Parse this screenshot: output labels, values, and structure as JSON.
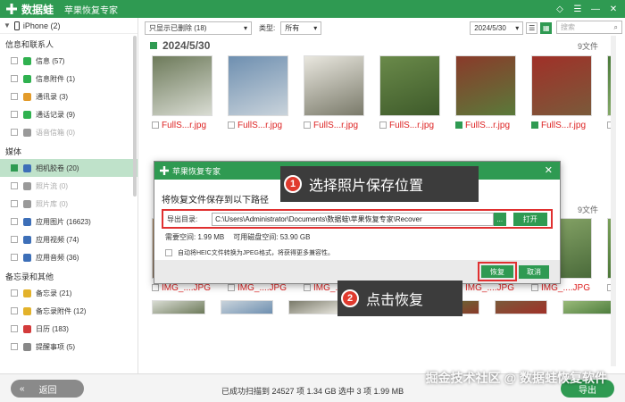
{
  "app": {
    "brand": "数据蛙",
    "title": "苹果恢复专家"
  },
  "device": {
    "label": "iPhone (2)"
  },
  "sidebar": {
    "groups": [
      {
        "title": "信息和联系人",
        "items": [
          {
            "label": "信息 (57)",
            "color": "#2fb14f",
            "disabled": false
          },
          {
            "label": "信息附件 (1)",
            "color": "#2fb14f",
            "disabled": false
          },
          {
            "label": "通讯录 (3)",
            "color": "#e39b2a",
            "disabled": false
          },
          {
            "label": "通话记录 (9)",
            "color": "#2fb14f",
            "disabled": false
          },
          {
            "label": "语音信箱 (0)",
            "color": "#999999",
            "disabled": true
          }
        ]
      },
      {
        "title": "媒体",
        "items": [
          {
            "label": "相机胶卷 (20)",
            "color": "#3d6fb8",
            "disabled": false,
            "active": true,
            "checked": true
          },
          {
            "label": "照片流 (0)",
            "color": "#999999",
            "disabled": true
          },
          {
            "label": "照片库 (0)",
            "color": "#999999",
            "disabled": true
          },
          {
            "label": "应用图片 (16623)",
            "color": "#3d6fb8",
            "disabled": false
          },
          {
            "label": "应用视频 (74)",
            "color": "#3d6fb8",
            "disabled": false
          },
          {
            "label": "应用音频 (36)",
            "color": "#3d6fb8",
            "disabled": false
          }
        ]
      },
      {
        "title": "备忘录和其他",
        "items": [
          {
            "label": "备忘录 (21)",
            "color": "#e3b22a",
            "disabled": false
          },
          {
            "label": "备忘录附件 (12)",
            "color": "#e3b22a",
            "disabled": false
          },
          {
            "label": "日历 (183)",
            "color": "#d33b3b",
            "disabled": false
          },
          {
            "label": "提醒事项 (5)",
            "color": "#888888",
            "disabled": false
          }
        ]
      }
    ]
  },
  "toolbar": {
    "filter": "只显示已删除 (18)",
    "type_label": "类型:",
    "type_value": "所有",
    "date_value": "2024/5/30",
    "search_placeholder": "搜索"
  },
  "content": {
    "date": "2024/5/30",
    "count": "9文件",
    "count2": "9文件",
    "row1": [
      {
        "name": "FullS...r.jpg",
        "checked": false,
        "c1": "#6d7a5a",
        "c2": "#d9dcd3"
      },
      {
        "name": "FullS...r.jpg",
        "checked": false,
        "c1": "#6e8fb0",
        "c2": "#c9d3db"
      },
      {
        "name": "FullS...r.jpg",
        "checked": false,
        "c1": "#e9e7df",
        "c2": "#7a7a6a"
      },
      {
        "name": "FullS...r.jpg",
        "checked": false,
        "c1": "#6a8a4a",
        "c2": "#3e5a2a"
      },
      {
        "name": "FullS...r.jpg",
        "checked": true,
        "c1": "#8a3a2a",
        "c2": "#5a7a3a"
      },
      {
        "name": "FullS...r.jpg",
        "checked": true,
        "c1": "#a03028",
        "c2": "#7a5a3a"
      },
      {
        "name": "FullS...r.jpg",
        "checked": false,
        "c1": "#4a7a3a",
        "c2": "#9aba7a"
      }
    ],
    "row2": [
      {
        "name": "IMG_....JPG",
        "c1": "#b58a5a",
        "c2": "#6a5a4a"
      },
      {
        "name": "IMG_....JPG",
        "c1": "#6d8fb0",
        "c2": "#c0ccd6"
      },
      {
        "name": "IMG_....JPG",
        "c1": "#e8e6dc",
        "c2": "#6a6a5a"
      },
      {
        "name": "IMG_....JPG",
        "c1": "#5a8a3a",
        "c2": "#2e4a1e"
      },
      {
        "name": "IMG_....JPG",
        "c1": "#6a9a4a",
        "c2": "#3a5a2a"
      },
      {
        "name": "IMG_....JPG",
        "c1": "#8aa86a",
        "c2": "#4a6a3a"
      },
      {
        "name": "IMG_....JPG",
        "c1": "#7aa05a",
        "c2": "#3e6a2e"
      }
    ]
  },
  "dialog": {
    "title": "苹果恢复专家",
    "close": "✕",
    "desc": "将恢复文件保存到以下路径",
    "path_label": "导出目录:",
    "path_value": "C:\\Users\\Administrator\\Documents\\数据蛙\\苹果恢复专家\\Recover",
    "dots": "...",
    "open": "打开",
    "required": "需要空间:  1.99 MB",
    "available": "可用磁盘空间:  53.90 GB",
    "heic": "自动将HEIC文件转换为JPEG格式，将获得更多兼容性。",
    "recover": "恢复",
    "cancel": "取消"
  },
  "callouts": {
    "one_num": "1",
    "one_text": "选择照片保存位置",
    "two_num": "2",
    "two_text": "点击恢复"
  },
  "status": {
    "back": "返回",
    "summary": "已成功扫描到 24527 项 1.34 GB  选中 3 项 1.99 MB",
    "export": "导出",
    "watermark": "掘金技术社区 @ 数据蛙恢复软件"
  },
  "colors": {
    "brand": "#2f9a52",
    "highlight": "#e03030",
    "active_row": "#bfe2ca"
  }
}
